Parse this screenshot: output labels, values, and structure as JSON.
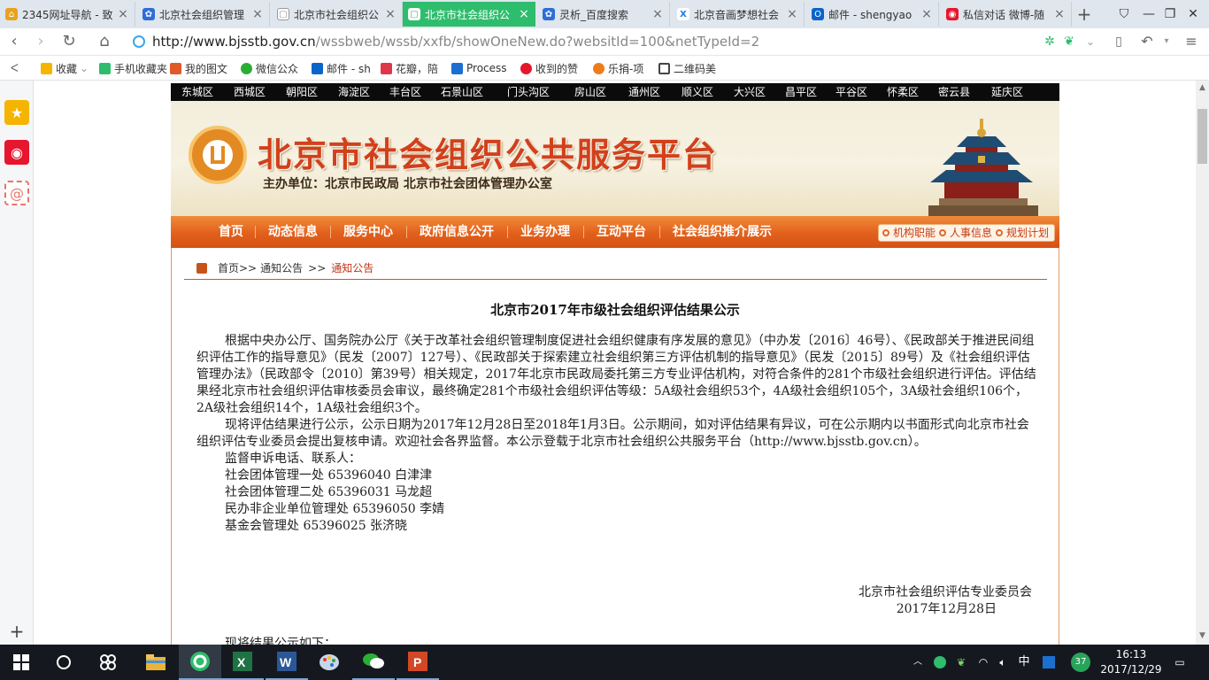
{
  "tabs": [
    {
      "title": "2345网址导航 - 致",
      "color": "#e8a31c"
    },
    {
      "title": "北京社会组织管理",
      "color": "#2e6dd8"
    },
    {
      "title": "北京市社会组织公",
      "color": "#999999"
    },
    {
      "title": "北京市社会组织公",
      "color": "#ffffff"
    },
    {
      "title": "灵析_百度搜索",
      "color": "#2e6dd8"
    },
    {
      "title": "北京音画梦想社会",
      "color": "#1f7ce0"
    },
    {
      "title": "邮件 - shengyao",
      "color": "#0a64c9"
    },
    {
      "title": "私信对话 微博-随",
      "color": "#e6162d"
    }
  ],
  "address": {
    "host": "http://www.bjsstb.gov.cn",
    "path": "/wssbweb/wssb/xxfb/showOneNew.do?websitId=100&netTypeId=2"
  },
  "bookmarks": [
    {
      "label": "收藏",
      "color": "#f5b400"
    },
    {
      "label": "手机收藏夹",
      "color": "#2ebd6d"
    },
    {
      "label": "我的图文",
      "color": "#e05a2a"
    },
    {
      "label": "微信公众",
      "color": "#2aae34"
    },
    {
      "label": "邮件 - sh",
      "color": "#0a64c9"
    },
    {
      "label": "花瓣，陪",
      "color": "#e0364a"
    },
    {
      "label": "Process",
      "color": "#1b6fd1"
    },
    {
      "label": "收到的赞",
      "color": "#e6162d"
    },
    {
      "label": "乐捐-项",
      "color": "#f07b1a"
    },
    {
      "label": "二维码美",
      "color": "#444444"
    }
  ],
  "site": {
    "districts": [
      "东城区",
      "西城区",
      "朝阳区",
      "海淀区",
      "丰台区",
      "石景山区",
      "门头沟区",
      "房山区",
      "通州区",
      "顺义区",
      "大兴区",
      "昌平区",
      "平谷区",
      "怀柔区",
      "密云县",
      "延庆区"
    ],
    "title": "北京市社会组织公共服务平台",
    "host_unit": "主办单位：北京市民政局 北京市社会团体管理办公室",
    "menu": [
      "首页",
      "动态信息",
      "服务中心",
      "政府信息公开",
      "业务办理",
      "互动平台",
      "社会组织推介展示"
    ],
    "quick_links": [
      "机构职能",
      "人事信息",
      "规划计划"
    ]
  },
  "breadcrumb": {
    "home": "首页>>",
    "section": "通知公告",
    "sep": ">>",
    "current": "通知公告"
  },
  "article": {
    "title": "北京市2017年市级社会组织评估结果公示",
    "p1": "根据中央办公厅、国务院办公厅《关于改革社会组织管理制度促进社会组织健康有序发展的意见》（中办发〔2016〕46号）、《民政部关于推进民间组织评估工作的指导意见》（民发〔2007〕127号）、《民政部关于探索建立社会组织第三方评估机制的指导意见》（民发〔2015〕89号）及《社会组织评估管理办法》（民政部令〔2010〕第39号）相关规定，2017年北京市民政局委托第三方专业评估机构，对符合条件的281个市级社会组织进行评估。评估结果经北京市社会组织评估审核委员会审议，最终确定281个市级社会组织评估等级：5A级社会组织53个，4A级社会组织105个，3A级社会组织106个，2A级社会组织14个，1A级社会组织3个。",
    "p2": "现将评估结果进行公示，公示日期为2017年12月28日至2018年1月3日。公示期间，如对评估结果有异议，可在公示期内以书面形式向北京市社会组织评估专业委员会提出复核申请。欢迎社会各界监督。本公示登载于北京市社会组织公共服务平台（http://www.bjsstb.gov.cn）。",
    "contact_head": "监督申诉电话、联系人：",
    "contacts": [
      "社会团体管理一处  65396040  白津津",
      "社会团体管理二处  65396031  马龙超",
      "民办非企业单位管理处  65396050  李婧",
      "基金会管理处  65396025  张济晓"
    ],
    "sign_org": "北京市社会组织评估专业委员会",
    "sign_date": "2017年12月28日",
    "tail": "现将结果公示如下："
  },
  "taskbar": {
    "time": "16:13",
    "date": "2017/12/29",
    "ime": "中",
    "badge": "37"
  }
}
